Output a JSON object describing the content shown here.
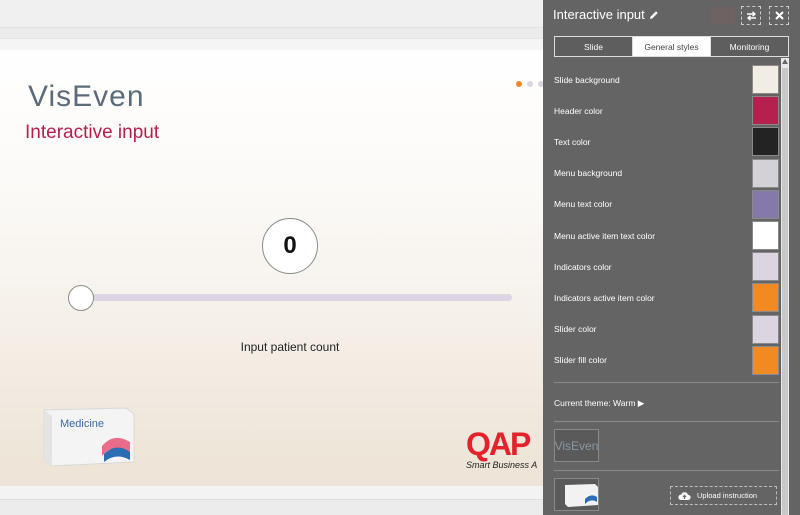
{
  "slide": {
    "logo_text": "VisEven",
    "title": "Interactive input",
    "counter_value": "0",
    "slider_value": 0,
    "input_label": "Input patient count",
    "medicine_text": "Medicine",
    "partner_logo_big": "QAP",
    "partner_logo_small": "Smart Business A",
    "indicators": {
      "count": 3,
      "active_index": 0
    }
  },
  "panel": {
    "title": "Interactive input",
    "tabs": [
      {
        "label": "Slide",
        "active": false
      },
      {
        "label": "General styles",
        "active": true
      },
      {
        "label": "Monitoring",
        "active": false
      }
    ],
    "colors": [
      {
        "label": "Slide background",
        "color": "#f1ece4"
      },
      {
        "label": "Header color",
        "color": "#b5204f"
      },
      {
        "label": "Text color",
        "color": "#232323"
      },
      {
        "label": "Menu background",
        "color": "#d3d0d7"
      },
      {
        "label": "Menu text color",
        "color": "#8479a8"
      },
      {
        "label": "Menu active item text color",
        "color": "#ffffff"
      },
      {
        "label": "Indicators color",
        "color": "#ddd4e2"
      },
      {
        "label": "Indicators active item color",
        "color": "#f28a24"
      },
      {
        "label": "Slider color",
        "color": "#ddd4e2"
      },
      {
        "label": "Slider fill color",
        "color": "#f28a24"
      }
    ],
    "theme_text": "Current theme: Warm ▶",
    "logo_thumb_text": "VisEven",
    "upload_label": "Upload instruction"
  },
  "icons": {
    "edit": "pencil-icon",
    "swap": "swap-icon",
    "close": "close-icon",
    "upload": "cloud-upload-icon"
  }
}
